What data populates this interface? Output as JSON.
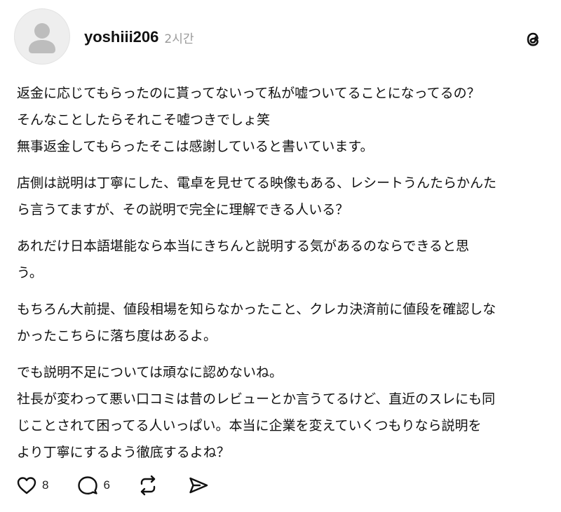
{
  "post": {
    "username": "yoshiii206",
    "timestamp": "2시간",
    "paragraphs": [
      {
        "lines": [
          "返金に応じてもらったのに貰ってないって私が嘘ついてることになってるの？",
          "そんなことしたらそれこそ嘘つきでしょ笑",
          "無事返金してもらったそこは感謝していると書いています。"
        ]
      },
      {
        "lines": [
          "店側は説明は丁寧にした、電卓を見せてる映像もある、レシートうんたらかんた",
          "ら言うてますが、その説明で完全に理解できる人いる？"
        ]
      },
      {
        "lines": [
          "あれだけ日本語堪能なら本当にきちんと説明する気があるのならできると思",
          "う。"
        ]
      },
      {
        "lines": [
          "もちろん大前提、値段相場を知らなかったこと、クレカ決済前に値段を確認しな",
          "かったこちらに落ち度はあるよ。"
        ]
      },
      {
        "lines": [
          "でも説明不足については頑なに認めないね。",
          "社長が変わって悪い口コミは昔のレビューとか言うてるけど、直近のスレにも同",
          "じことされて困ってる人いっぱい。本当に企業を変えていくつもりなら説明を",
          "より丁寧にするよう徹底するよね？"
        ]
      }
    ],
    "actions": {
      "like_count": "8",
      "reply_count": "6"
    },
    "icons": {
      "avatar": "default-avatar-icon",
      "logo": "threads-logo-icon",
      "like": "heart-icon",
      "reply": "speech-bubble-icon",
      "repost": "repost-icon",
      "share": "send-icon"
    },
    "colors": {
      "text": "#111111",
      "muted": "#9a9a9a",
      "avatar_bg": "#eeeeee",
      "avatar_figure": "#bdbdbd"
    }
  }
}
